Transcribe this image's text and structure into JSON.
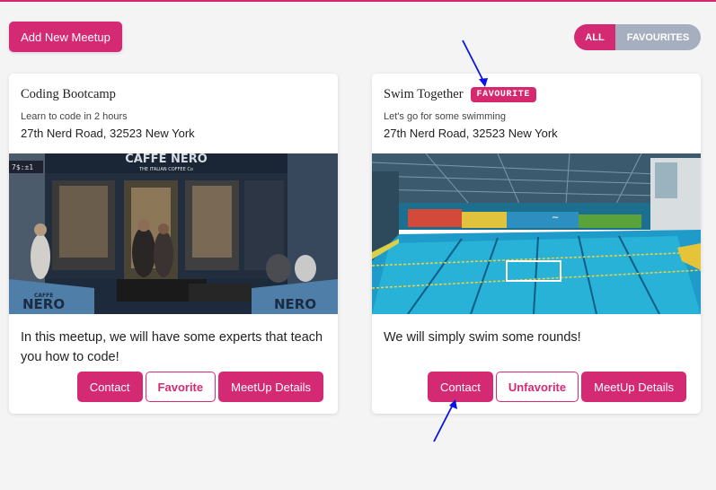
{
  "header": {
    "add_button": "Add New Meetup",
    "filter_all": "ALL",
    "filter_favourites": "FAVOURITES"
  },
  "meetups": [
    {
      "title": "Coding Bootcamp",
      "subtitle": "Learn to code in 2 hours",
      "address": "27th Nerd Road, 32523 New York",
      "image": "cafe-nero-storefront",
      "description": "In this meetup, we will have some experts that teach you how to code!",
      "buttons": {
        "contact": "Contact",
        "favorite": "Favorite",
        "details": "MeetUp Details"
      }
    },
    {
      "title": "Swim Together",
      "badge": "FAVOURITE",
      "subtitle": "Let's go for some swimming",
      "address": "27th Nerd Road, 32523 New York",
      "image": "indoor-swimming-pool",
      "description": "We will simply swim some rounds!",
      "buttons": {
        "contact": "Contact",
        "favorite": "Unfavorite",
        "details": "MeetUp Details"
      }
    }
  ],
  "colors": {
    "accent": "#d42a73",
    "filter_inactive": "#a5afbf",
    "background": "#f4f4f5",
    "annotation_arrow": "#0a14e6"
  },
  "image_texts": {
    "cafe_sign": "CAFFE NERO",
    "cafe_sub": "THE ITALIAN COFFEE Co",
    "window_price": "7$:±1",
    "awning_brand": "CAFFE",
    "awning_name": "NERO"
  }
}
